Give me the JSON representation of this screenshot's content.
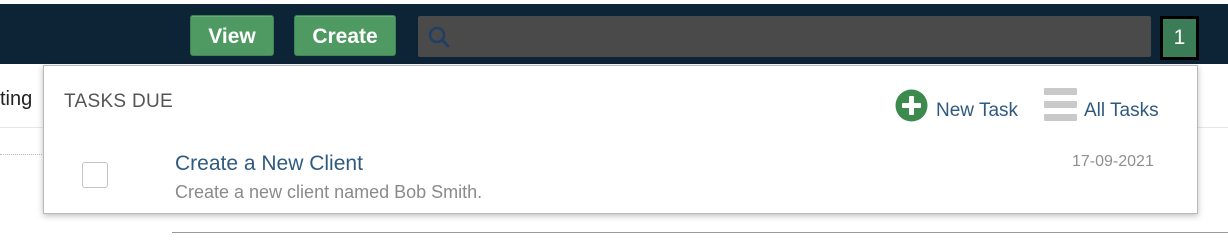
{
  "topbar": {
    "view_label": "View",
    "create_label": "Create",
    "search": {
      "value": "",
      "placeholder": ""
    },
    "badge_count": "1"
  },
  "background": {
    "left_tab_fragment": "ting"
  },
  "tasks_panel": {
    "title": "TASKS DUE",
    "new_task_label": "New Task",
    "all_tasks_label": "All Tasks",
    "tasks": [
      {
        "title": "Create a New Client",
        "description": "Create a new client named Bob Smith.",
        "due_date": "17-09-2021",
        "checked": false
      }
    ]
  },
  "colors": {
    "topbar_bg": "#0d2336",
    "button_green": "#4e9a62",
    "badge_green": "#3a7d56",
    "link_blue": "#2f5a80",
    "plus_green": "#3c8a4e"
  },
  "icons": [
    "search-icon",
    "plus-circle-icon",
    "list-lines-icon"
  ]
}
